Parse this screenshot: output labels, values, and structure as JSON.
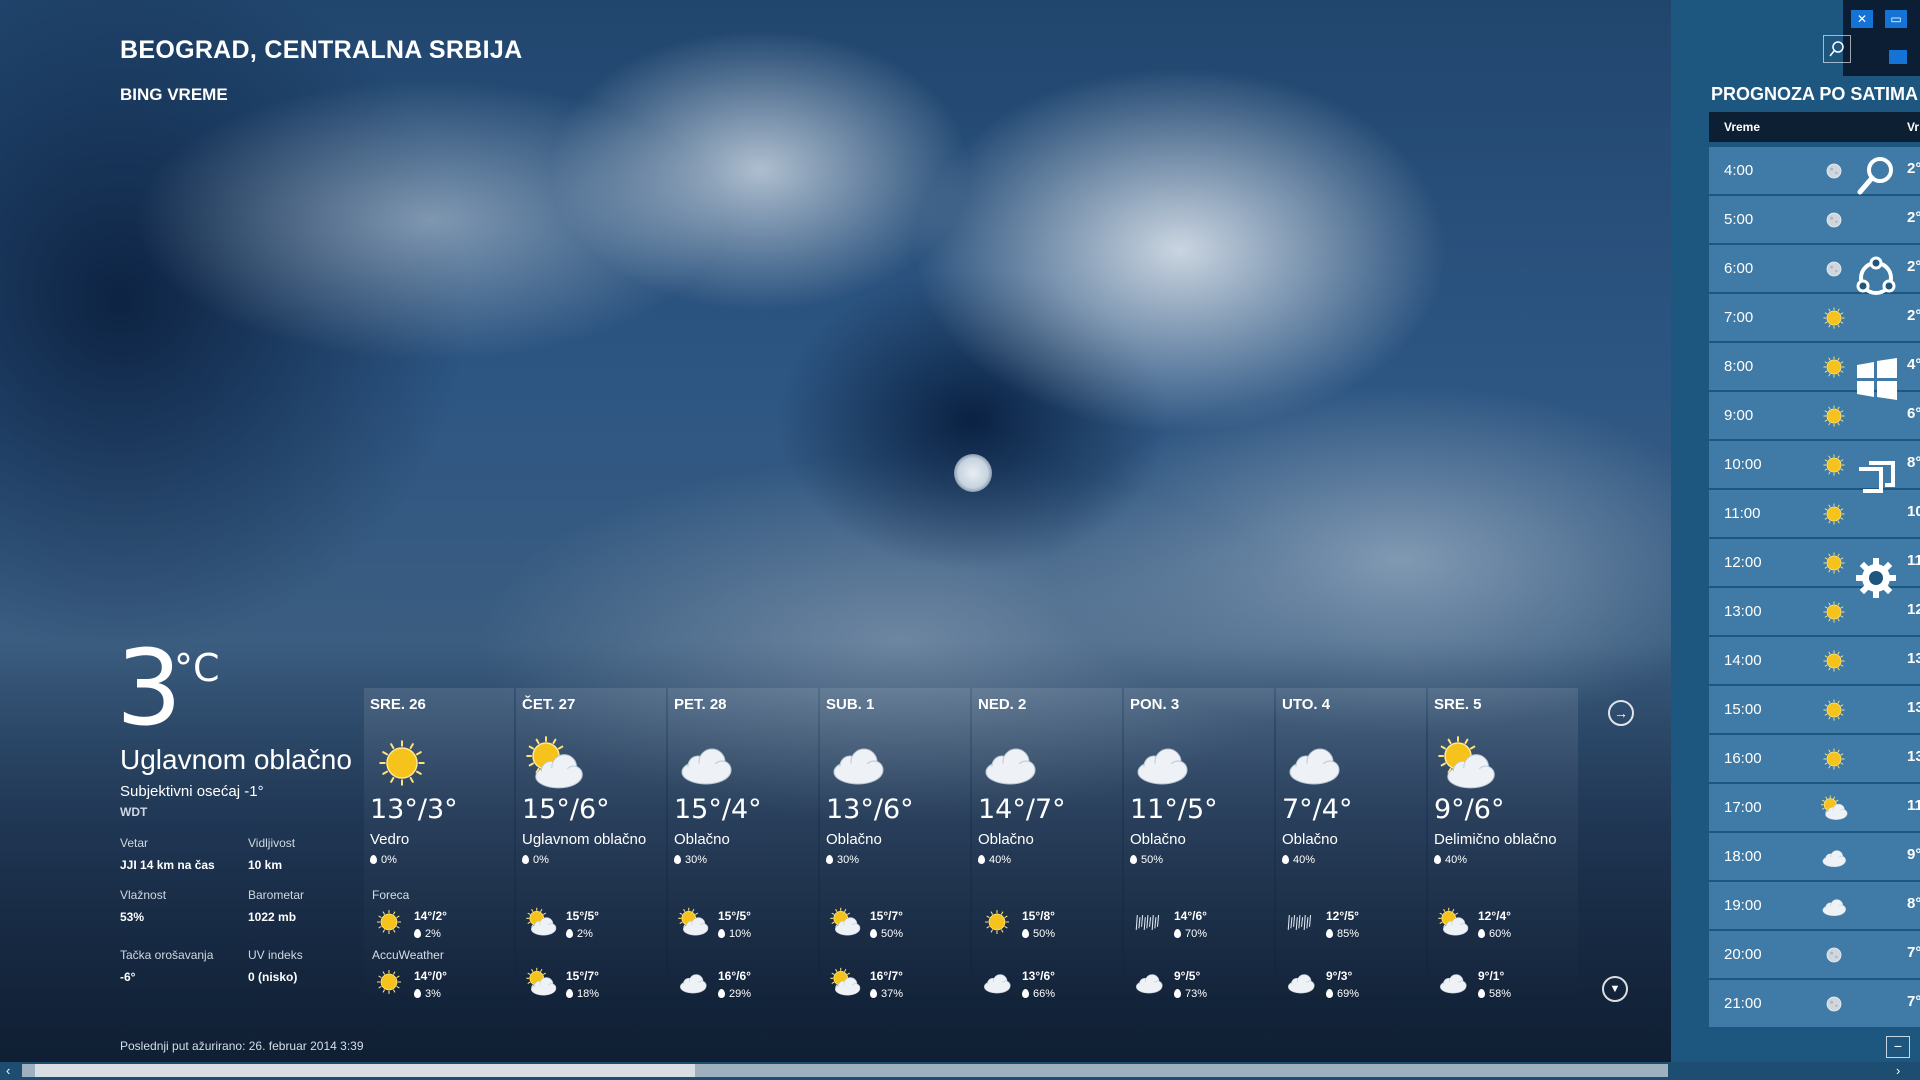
{
  "location": {
    "title": "BEOGRAD, CENTRALNA SRBIJA",
    "app_name": "BING VREME"
  },
  "current": {
    "temp": "3",
    "unit": "°C",
    "condition": "Uglavnom oblačno",
    "feels_like": "Subjektivni osećaj -1°",
    "source": "WDT",
    "stats": [
      {
        "label": "Vetar",
        "value": "JJI 14 km na čas"
      },
      {
        "label": "Vidljivost",
        "value": "10 km"
      },
      {
        "label": "Vlažnost",
        "value": "53%"
      },
      {
        "label": "Barometar",
        "value": "1022 mb"
      },
      {
        "label": "Tačka orošavanja",
        "value": "-6°"
      },
      {
        "label": "UV indeks",
        "value": "0 (nisko)"
      }
    ]
  },
  "sources": {
    "s1": "Foreca",
    "s2": "AccuWeather"
  },
  "days": [
    {
      "name": "SRE. 26",
      "icon": "sun-icon",
      "temps": "13°/3°",
      "cond": "Vedro",
      "precip": "0%",
      "f1": {
        "icon": "sun-icon",
        "temps": "14°/2°",
        "precip": "2%"
      },
      "f2": {
        "icon": "sun-icon",
        "temps": "14°/0°",
        "precip": "3%"
      }
    },
    {
      "name": "ČET. 27",
      "icon": "partly-cloudy-icon",
      "temps": "15°/6°",
      "cond": "Uglavnom oblačno",
      "precip": "0%",
      "f1": {
        "icon": "partly-cloudy-icon",
        "temps": "15°/5°",
        "precip": "2%"
      },
      "f2": {
        "icon": "partly-cloudy-icon",
        "temps": "15°/7°",
        "precip": "18%"
      }
    },
    {
      "name": "PET. 28",
      "icon": "cloud-icon",
      "temps": "15°/4°",
      "cond": "Oblačno",
      "precip": "30%",
      "f1": {
        "icon": "partly-cloudy-icon",
        "temps": "15°/5°",
        "precip": "10%"
      },
      "f2": {
        "icon": "cloud-icon",
        "temps": "16°/6°",
        "precip": "29%"
      }
    },
    {
      "name": "SUB. 1",
      "icon": "cloud-icon",
      "temps": "13°/6°",
      "cond": "Oblačno",
      "precip": "30%",
      "f1": {
        "icon": "partly-cloudy-icon",
        "temps": "15°/7°",
        "precip": "50%"
      },
      "f2": {
        "icon": "partly-cloudy-icon",
        "temps": "16°/7°",
        "precip": "37%"
      }
    },
    {
      "name": "NED. 2",
      "icon": "cloud-icon",
      "temps": "14°/7°",
      "cond": "Oblačno",
      "precip": "40%",
      "f1": {
        "icon": "sun-icon",
        "temps": "15°/8°",
        "precip": "50%"
      },
      "f2": {
        "icon": "cloud-icon",
        "temps": "13°/6°",
        "precip": "66%"
      }
    },
    {
      "name": "PON. 3",
      "icon": "cloud-icon",
      "temps": "11°/5°",
      "cond": "Oblačno",
      "precip": "50%",
      "f1": {
        "icon": "rain-icon",
        "temps": "14°/6°",
        "precip": "70%"
      },
      "f2": {
        "icon": "cloud-icon",
        "temps": "9°/5°",
        "precip": "73%"
      }
    },
    {
      "name": "UTO. 4",
      "icon": "cloud-icon",
      "temps": "7°/4°",
      "cond": "Oblačno",
      "precip": "40%",
      "f1": {
        "icon": "rain-icon",
        "temps": "12°/5°",
        "precip": "85%"
      },
      "f2": {
        "icon": "cloud-icon",
        "temps": "9°/3°",
        "precip": "69%"
      }
    },
    {
      "name": "SRE. 5",
      "icon": "partly-cloudy-icon",
      "temps": "9°/6°",
      "cond": "Delimično oblačno",
      "precip": "40%",
      "f1": {
        "icon": "partly-cloudy-icon",
        "temps": "12°/4°",
        "precip": "60%"
      },
      "f2": {
        "icon": "cloud-icon",
        "temps": "9°/1°",
        "precip": "58%"
      }
    }
  ],
  "updated": "Poslednji put ažurirano: 26. februar 2014 3:39",
  "hourly": {
    "title": "PROGNOZA PO SATIMA",
    "col_time": "Vreme",
    "col_other": "Vr",
    "rows": [
      {
        "time": "4:00",
        "icon": "moon-icon",
        "temp": "2°"
      },
      {
        "time": "5:00",
        "icon": "moon-icon",
        "temp": "2°"
      },
      {
        "time": "6:00",
        "icon": "moon-icon",
        "temp": "2°"
      },
      {
        "time": "7:00",
        "icon": "sun-icon",
        "temp": "2°"
      },
      {
        "time": "8:00",
        "icon": "sun-icon",
        "temp": "4°"
      },
      {
        "time": "9:00",
        "icon": "sun-icon",
        "temp": "6°"
      },
      {
        "time": "10:00",
        "icon": "sun-icon",
        "temp": "8°"
      },
      {
        "time": "11:00",
        "icon": "sun-icon",
        "temp": "10"
      },
      {
        "time": "12:00",
        "icon": "sun-icon",
        "temp": "11"
      },
      {
        "time": "13:00",
        "icon": "sun-icon",
        "temp": "12"
      },
      {
        "time": "14:00",
        "icon": "sun-icon",
        "temp": "13"
      },
      {
        "time": "15:00",
        "icon": "sun-icon",
        "temp": "13"
      },
      {
        "time": "16:00",
        "icon": "sun-icon",
        "temp": "13"
      },
      {
        "time": "17:00",
        "icon": "partly-cloudy-icon",
        "temp": "11"
      },
      {
        "time": "18:00",
        "icon": "cloud-icon",
        "temp": "9°"
      },
      {
        "time": "19:00",
        "icon": "cloud-icon",
        "temp": "8°"
      },
      {
        "time": "20:00",
        "icon": "moon-icon",
        "temp": "7°"
      },
      {
        "time": "21:00",
        "icon": "moon-icon",
        "temp": "7°"
      }
    ]
  },
  "colors": {
    "accent": "#1d567f",
    "row": "#3f7ba6",
    "header": "#0d1f33",
    "sun": "#f6c21c"
  }
}
